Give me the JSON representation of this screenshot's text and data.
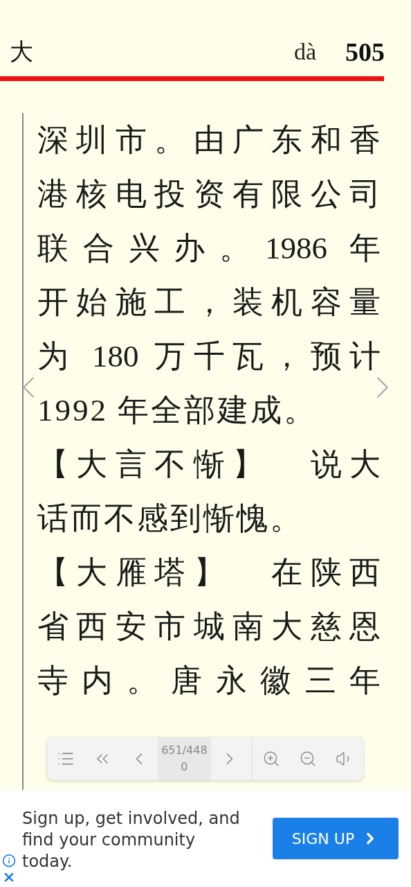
{
  "header": {
    "headword": "大",
    "pinyin": "dà",
    "page_number": "505"
  },
  "lines": [
    {
      "text": "深圳市。由广东和香",
      "kind": "full"
    },
    {
      "text": "港核电投资有限公司",
      "kind": "full"
    },
    {
      "text": "联合兴办。1986 年",
      "kind": "full"
    },
    {
      "text": "开始施工，装机容量",
      "kind": "full"
    },
    {
      "text": "为 180 万千瓦，预计",
      "kind": "full"
    },
    {
      "text": "1992 年全部建成。",
      "kind": "end"
    },
    {
      "text": "【大言不惭】　说大",
      "kind": "full"
    },
    {
      "text": "话而不感到惭愧。",
      "kind": "end"
    },
    {
      "text": "【大雁塔】　在陕西",
      "kind": "full"
    },
    {
      "text": "省西安市城南大慈恩",
      "kind": "full"
    },
    {
      "text": "寺内。唐永徽三年",
      "kind": "full"
    }
  ],
  "toolbar": {
    "page": "651/4480"
  },
  "ad": {
    "text": "Sign up, get involved, and find your community today.",
    "button": "SIGN UP"
  }
}
